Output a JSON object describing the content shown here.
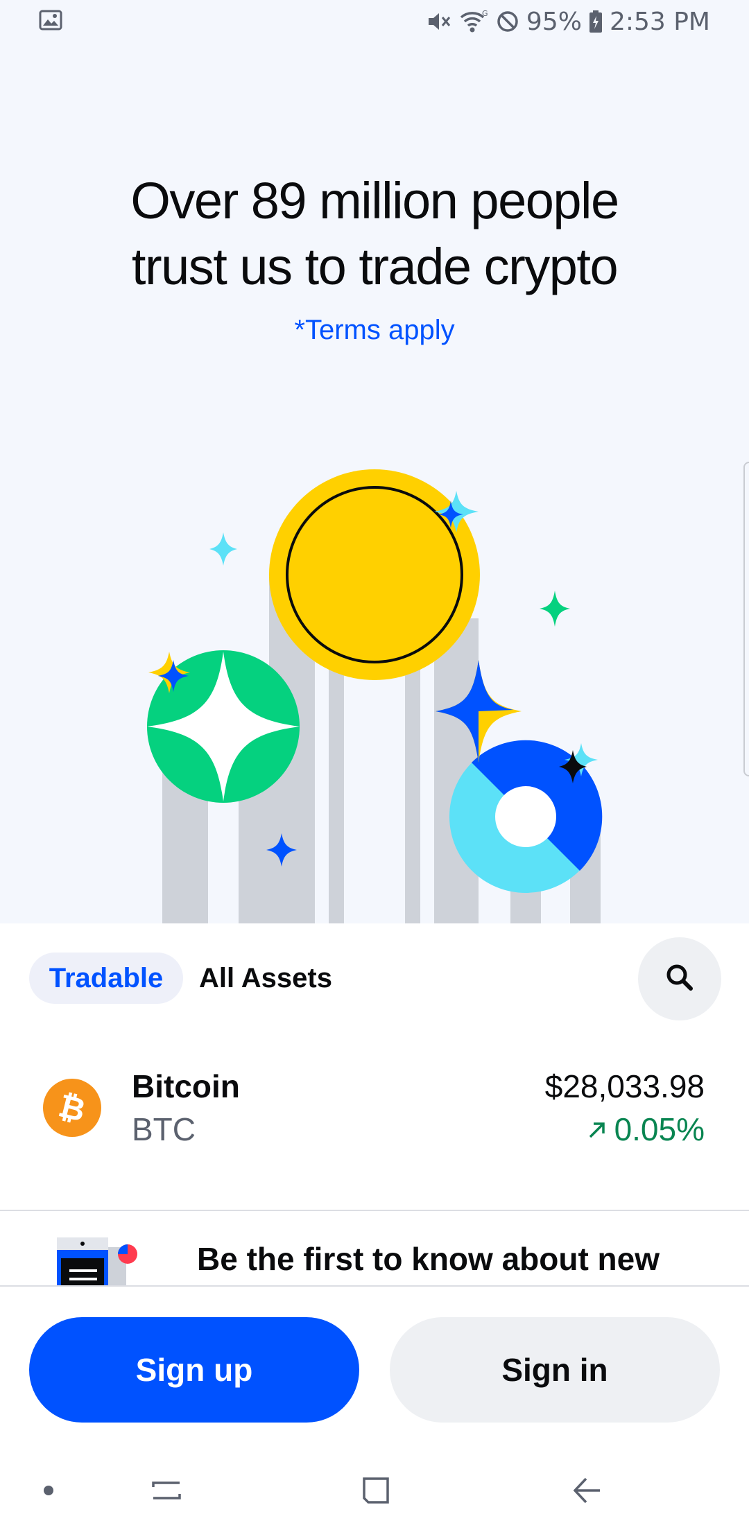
{
  "status_bar": {
    "battery": "95%",
    "time": "2:53 PM",
    "icons": [
      "image-icon",
      "mute-icon",
      "wifi-icon",
      "do-not-disturb-icon",
      "battery-icon"
    ]
  },
  "hero": {
    "headline_line1": "Over 89 million people",
    "headline_line2": "trust us to trade crypto",
    "terms_link": "*Terms apply"
  },
  "tabs": {
    "tradable": "Tradable",
    "all_assets": "All Assets",
    "search_icon": "search-icon"
  },
  "assets": [
    {
      "name": "Bitcoin",
      "symbol": "BTC",
      "price": "$28,033.98",
      "change": "0.05%",
      "change_direction": "up",
      "icon": "bitcoin-icon",
      "icon_color": "#f7931a"
    }
  ],
  "promo": {
    "text": "Be the first to know about new"
  },
  "actions": {
    "sign_up": "Sign up",
    "sign_in": "Sign in"
  },
  "colors": {
    "brand_blue": "#0052ff",
    "positive_green": "#098551",
    "hero_background": "#f4f7fd"
  },
  "nav_bar": {
    "icons": [
      "dot-icon",
      "recents-icon",
      "home-icon",
      "back-icon"
    ]
  }
}
